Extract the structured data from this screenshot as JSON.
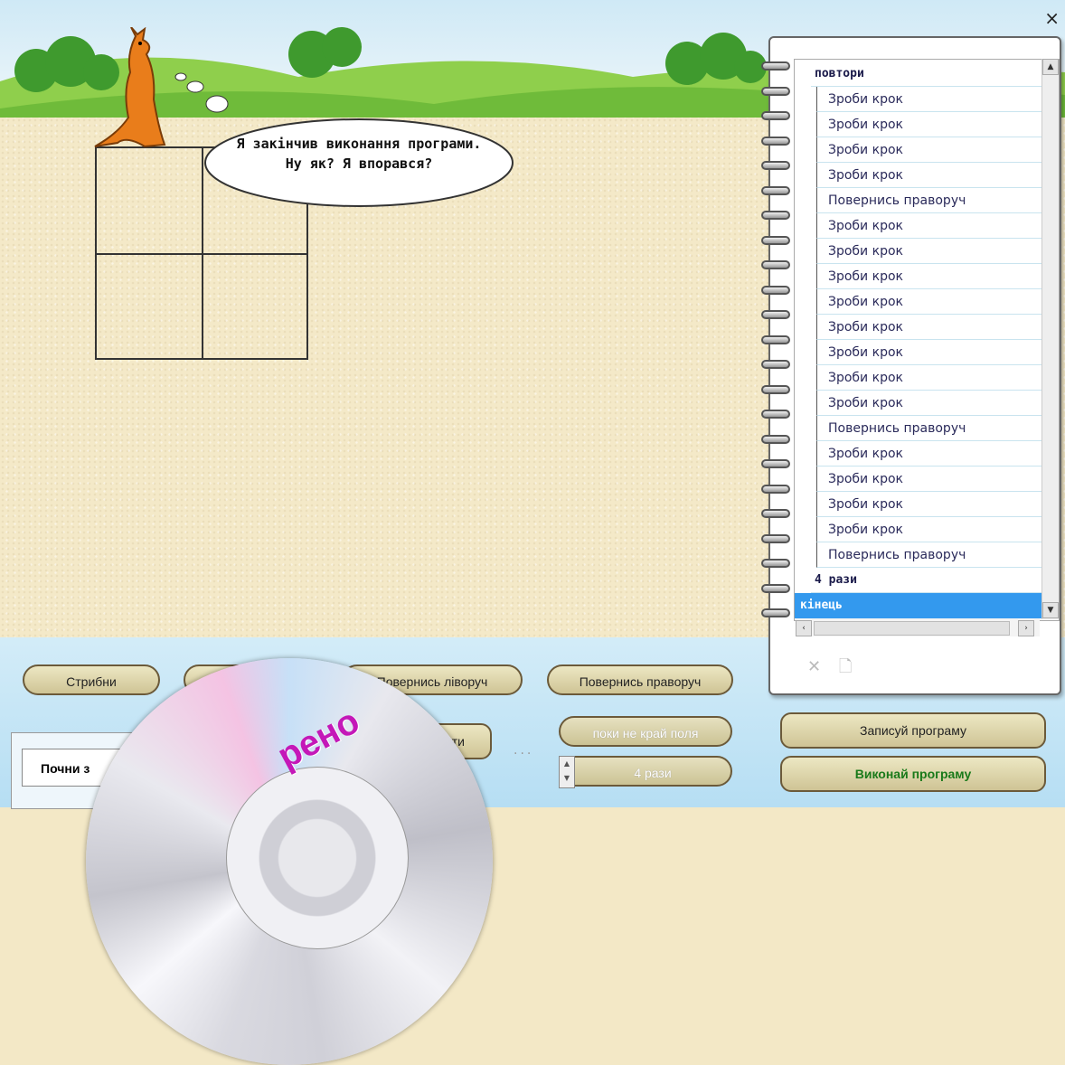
{
  "window": {
    "close_glyph": "×"
  },
  "speech": {
    "line1": "Я закінчив виконання програми.",
    "line2": "Ну як? Я впорався?"
  },
  "program": {
    "header": "повтори",
    "commands": [
      "Зроби крок",
      "Зроби крок",
      "Зроби крок",
      "Зроби крок",
      "Повернись праворуч",
      "Зроби крок",
      "Зроби крок",
      "Зроби крок",
      "Зроби крок",
      "Зроби крок",
      "Зроби крок",
      "Зроби крок",
      "Зроби крок",
      "Повернись праворуч",
      "Зроби крок",
      "Зроби крок",
      "Зроби крок",
      "Зроби крок",
      "Повернись праворуч"
    ],
    "repeat_count": "4 рази",
    "end": "кінець"
  },
  "controls": {
    "jump": "Стрибни",
    "turn_left": "Повернись ліворуч",
    "turn_right": "Повернись праворуч",
    "until_edge": "поки не край поля",
    "times": "4 рази",
    "record": "Записуй програму",
    "execute": "Виконай програму",
    "start": "Почни з",
    "repeat_partial": "ти",
    "dots": "..."
  },
  "overlay": {
    "cd_text": "рено"
  },
  "colors": {
    "selected_row": "#3399ee",
    "execute_text": "#1a7a1a"
  }
}
